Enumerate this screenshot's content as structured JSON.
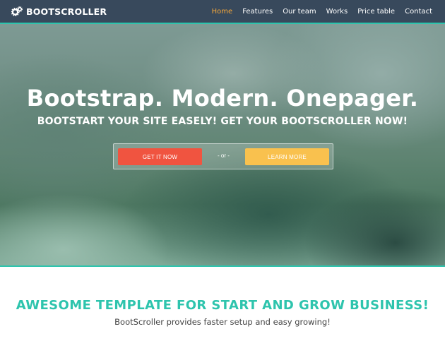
{
  "navbar": {
    "brand": "BOOTSCROLLER",
    "brand_icon": "cogs-icon",
    "items": [
      {
        "label": "Home",
        "active": true
      },
      {
        "label": "Features",
        "active": false
      },
      {
        "label": "Our team",
        "active": false
      },
      {
        "label": "Works",
        "active": false
      },
      {
        "label": "Price table",
        "active": false
      },
      {
        "label": "Contact",
        "active": false
      }
    ]
  },
  "hero": {
    "title": "Bootstrap. Modern. Onepager.",
    "subtitle": "BOOTSTART YOUR SITE EASELY! GET YOUR BOOTSCROLLER NOW!",
    "primary_button": "GET IT NOW",
    "separator": "- or -",
    "secondary_button": "LEARN MORE"
  },
  "intro": {
    "heading": "AWESOME TEMPLATE FOR START AND GROW BUSINESS!",
    "text": "BootScroller provides faster setup and easy growing!"
  },
  "colors": {
    "navbar_bg": "#38495c",
    "accent_teal": "#2ec4ad",
    "nav_active": "#f7a83a",
    "button_primary": "#f05440",
    "button_secondary": "#f9c14e"
  }
}
